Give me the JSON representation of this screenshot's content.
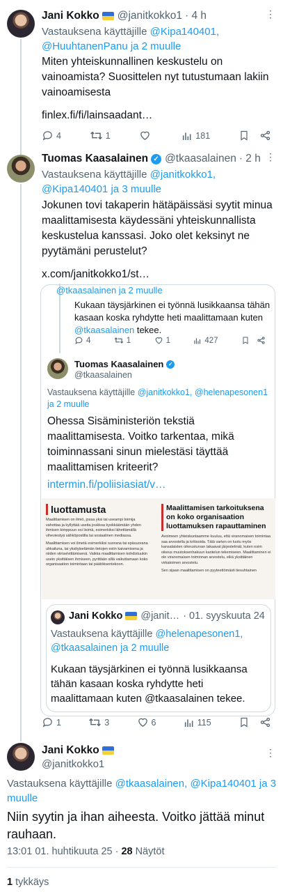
{
  "tweet1": {
    "name": "Jani Kokko",
    "handle": "@janitkokko1",
    "time": "· 4 h",
    "reply_prefix": "Vastauksena käyttäjille",
    "reply_users": "@Kipa140401, @HuuhtanenPanu ja 2 muulle",
    "text": "Miten yhteiskunnallinen keskustelu on vainoamista? Suosittelen nyt tutustumaan lakiin vainoamisesta",
    "link": "finlex.fi/fi/lainsaadant…",
    "replies": "4",
    "retweets": "1",
    "likes": "",
    "views": "181"
  },
  "tweet2": {
    "name": "Tuomas Kaasalainen",
    "handle": "@tkaasalainen",
    "time": "· 2 h",
    "reply_prefix": "Vastauksena käyttäjille",
    "reply_users": "@janitkokko1, @Kipa140401 ja 3 muulle",
    "text": "Jokunen tovi takaperin hätäpäissäsi syytit minua maalittamisesta käydessäni yhteiskunnallista keskustelua kanssasi. Joko olet keksinyt ne pyytämäni perustelut?",
    "link": "x.com/janitkokko1/st…"
  },
  "quote": {
    "top_users": "@tkaasalainen ja 2 muulle",
    "top_text": "Kukaan täysjärkinen ei työnnä lusikkaansa tähän kasaan koska ryhdytte heti maalittamaan kuten",
    "top_mention": "@tkaasalainen",
    "top_end": "tekee.",
    "top_replies": "4",
    "top_retweets": "1",
    "top_likes": "1",
    "top_views": "427",
    "name": "Tuomas Kaasalainen",
    "handle": "@tkaasalainen",
    "reply_prefix": "Vastauksena käyttäjille",
    "reply_users": "@janitkokko1, @helenapesonen1 ja 2 muulle",
    "text": "Ohessa Sisäministeriön tekstiä maalittamisesta. Voitko tarkentaa, mikä toiminnassani sinun mielestäsi täyttää maalittamisen kriteerit?",
    "link": "intermin.fi/poliisiasiat/v…",
    "img_left_title": "luottamusta",
    "img_left_p1": "Maalittamisen on ilmiö, jossa yksi tai useampi toimija vahottaa ja kyllyttää useita joukkoa kyokkäämään yhden ihmisen kimppuun esi lisimä, esimerkiksi lähettämällä viheviestyä sähköpostilla tai sosiaalinen mediassa.",
    "img_left_p2": "Maalittamisen voi ilmetä esimerkiksi suorana tai epäsuorana uhkailuna, tai yksityiselämän tietojen esiin kaivamisena ja niiden viiriselvittämisenä. Vaikka maalittamisen kohdistuukin usein yksittäisen ihmiseen, pyrittään sillä vaikuttamaan koko organisaation toimintaan tai päätöksentekoon.",
    "img_right_title": "Maalittamisen tarkoituksena on koko organisaation luottamuksen rapauttaminen",
    "img_right_p1": "Avoimeen yhteiskuntaamme kuuluu, että viranomaisen toimintaa saa arvostella ja kritisoida. Tätä varten on luotu myös kansalaisten oikeusturvan takaavat järjestelmät, kuten esim oikeus muutoksenhakuun kantelun tekemiseen. Maalittaminen ei ole viranomaisen toiminnan arvostelu, eikä yksittäinen virkatoimen arvostelu.",
    "img_right_p2": "Sen sijaan maalittamisen on pyyteettömästi tiesuhtainen",
    "inner_name": "Jani Kokko",
    "inner_handle": "@janit…",
    "inner_time": "· 01. syyskuuta 24",
    "inner_reply_prefix": "Vastauksena käyttäjille",
    "inner_reply_users": "@helenapesonen1, @tkaasalainen ja 2 muulle",
    "inner_text": "Kukaan täysjärkinen ei työnnä lusikkaansa tähän kasaan koska ryhdytte heti maalittamaan kuten @tkaasalainen tekee."
  },
  "tweet2_actions": {
    "replies": "1",
    "retweets": "3",
    "likes": "6",
    "views": "115"
  },
  "main": {
    "name": "Jani Kokko",
    "handle": "@janitkokko1",
    "reply_prefix": "Vastauksena käyttäjille",
    "reply_users": "@tkaasalainen, @Kipa140401 ja 3 muulle",
    "text": "Niin syytin ja ihan aiheesta. Voitko jättää minut rauhaan.",
    "timestamp": "13:01 01. huhtikuuta 25 ·",
    "views_count": "28",
    "views_label": "Näytöt",
    "likes_count": "1",
    "likes_label": "tykkäys"
  },
  "colors": {
    "accent": "#1d9bf0",
    "muted": "#536471",
    "border": "#cfd9de"
  }
}
